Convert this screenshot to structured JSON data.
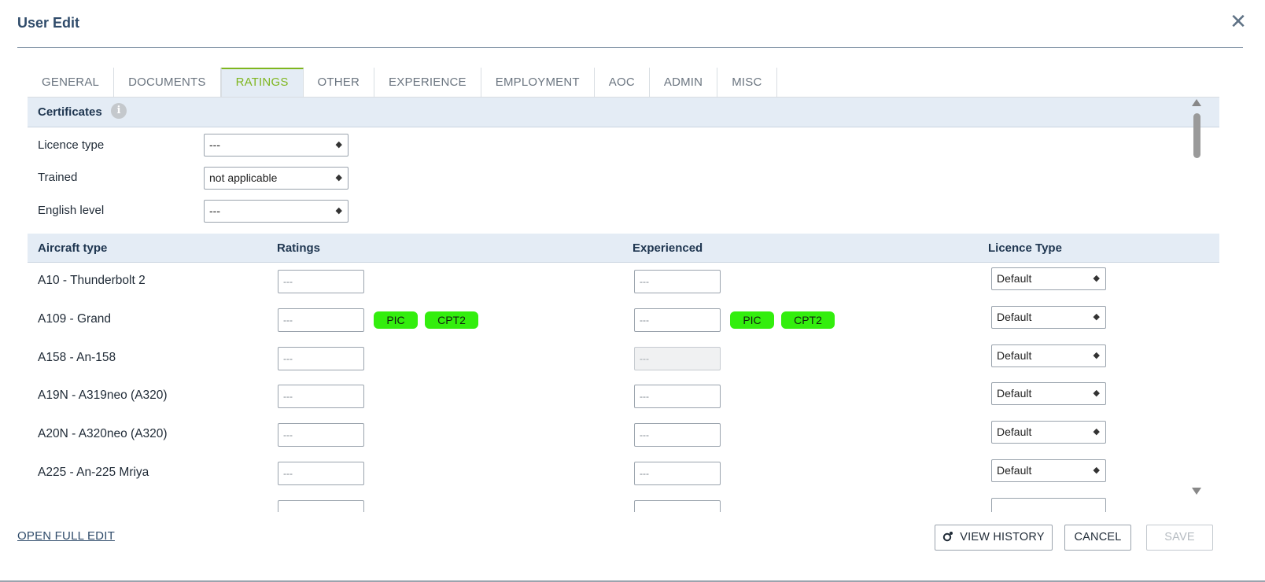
{
  "dialog": {
    "title": "User Edit",
    "close_symbol": "✕"
  },
  "tabs": [
    {
      "label": "GENERAL",
      "active": false
    },
    {
      "label": "DOCUMENTS",
      "active": false
    },
    {
      "label": "RATINGS",
      "active": true
    },
    {
      "label": "OTHER",
      "active": false
    },
    {
      "label": "EXPERIENCE",
      "active": false
    },
    {
      "label": "EMPLOYMENT",
      "active": false
    },
    {
      "label": "AOC",
      "active": false
    },
    {
      "label": "ADMIN",
      "active": false
    },
    {
      "label": "MISC",
      "active": false
    }
  ],
  "certificates": {
    "title": "Certificates",
    "info_icon": "i",
    "fields": [
      {
        "label": "Licence type",
        "value": "---"
      },
      {
        "label": "Trained",
        "value": "not applicable"
      },
      {
        "label": "English level",
        "value": "---"
      }
    ]
  },
  "grid": {
    "columns": [
      "Aircraft type",
      "Ratings",
      "Experienced",
      "Licence Type"
    ],
    "rows": [
      {
        "aircraft": "A10 - Thunderbolt 2",
        "ratings": "---",
        "ratings_chips": [],
        "experienced": "---",
        "experienced_disabled": false,
        "experienced_chips": [],
        "licence_type": "Default"
      },
      {
        "aircraft": "A109 - Grand",
        "ratings": "---",
        "ratings_chips": [
          "PIC",
          "CPT2"
        ],
        "experienced": "---",
        "experienced_disabled": false,
        "experienced_chips": [
          "PIC",
          "CPT2"
        ],
        "licence_type": "Default"
      },
      {
        "aircraft": "A158 - An-158",
        "ratings": "---",
        "ratings_chips": [],
        "experienced": "---",
        "experienced_disabled": true,
        "experienced_chips": [],
        "licence_type": "Default"
      },
      {
        "aircraft": "A19N - A319neo (A320)",
        "ratings": "---",
        "ratings_chips": [],
        "experienced": "---",
        "experienced_disabled": false,
        "experienced_chips": [],
        "licence_type": "Default"
      },
      {
        "aircraft": "A20N - A320neo (A320)",
        "ratings": "---",
        "ratings_chips": [],
        "experienced": "---",
        "experienced_disabled": false,
        "experienced_chips": [],
        "licence_type": "Default"
      },
      {
        "aircraft": "A225 - An-225 Mriya",
        "ratings": "---",
        "ratings_chips": [],
        "experienced": "---",
        "experienced_disabled": false,
        "experienced_chips": [],
        "licence_type": "Default"
      }
    ]
  },
  "footer": {
    "open_full_edit": "OPEN FULL EDIT",
    "view_history": "VIEW HISTORY",
    "cancel": "CANCEL",
    "save": "SAVE"
  },
  "colors": {
    "accent": "#7fb61f",
    "chip": "#33ee0e",
    "title": "#2f4b6a",
    "header_bg": "#e4ecf5"
  }
}
